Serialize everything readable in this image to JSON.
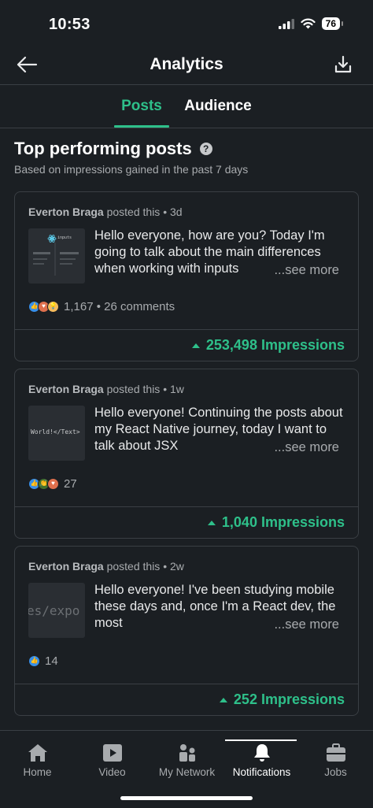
{
  "status_bar": {
    "time": "10:53",
    "battery": "76"
  },
  "header": {
    "title": "Analytics"
  },
  "tabs": [
    {
      "label": "Posts",
      "active": true
    },
    {
      "label": "Audience",
      "active": false
    }
  ],
  "section": {
    "title": "Top performing posts",
    "subtitle": "Based on impressions gained in the past 7 days"
  },
  "posts": [
    {
      "author": "Everton Braga",
      "action": " posted this • 3d",
      "text": "Hello everyone, how are you? Today I'm going to talk about the main differences when working with inputs",
      "see_more": "...see more",
      "reactions": "1,167 • 26 comments",
      "impressions": "253,498 Impressions",
      "thumbnail_text": "inputs"
    },
    {
      "author": "Everton Braga",
      "action": " posted this • 1w",
      "text": "Hello everyone! Continuing the posts about my React Native journey, today I want to talk about JSX",
      "see_more": "...see more",
      "reactions": "27",
      "impressions": "1,040 Impressions",
      "thumbnail_text": "World!</Text>"
    },
    {
      "author": "Everton Braga",
      "action": " posted this • 2w",
      "text": "Hello everyone! I've been studying mobile these days and, once I'm a React dev, the most",
      "see_more": "...see more",
      "reactions": "14",
      "impressions": "252 Impressions",
      "thumbnail_text": "es/expo"
    }
  ],
  "bottom_nav": [
    {
      "label": "Home",
      "icon": "home-icon"
    },
    {
      "label": "Video",
      "icon": "video-icon"
    },
    {
      "label": "My Network",
      "icon": "network-icon"
    },
    {
      "label": "Notifications",
      "icon": "bell-icon",
      "active": true
    },
    {
      "label": "Jobs",
      "icon": "briefcase-icon"
    }
  ],
  "colors": {
    "accent": "#2ec08a",
    "background": "#1b1f23",
    "border": "#3a3f44"
  }
}
